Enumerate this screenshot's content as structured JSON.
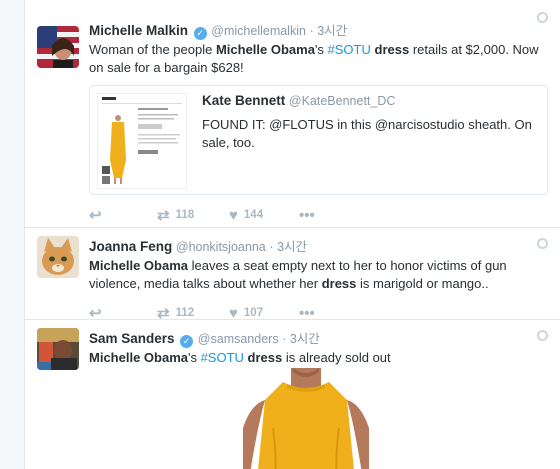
{
  "tweets": [
    {
      "name": "Michelle Malkin",
      "handle": "@michellemalkin",
      "time": "· 3시간",
      "segments": [
        {
          "t": "Woman of the people ",
          "s": ""
        },
        {
          "t": "Michelle Obama",
          "s": "b"
        },
        {
          "t": "'s ",
          "s": ""
        },
        {
          "t": "#SOTU",
          "s": "hl"
        },
        {
          "t": " ",
          "s": ""
        },
        {
          "t": "dress",
          "s": "b"
        },
        {
          "t": " retails at $2,000. Now on sale for a bargain $628!",
          "s": ""
        }
      ],
      "quote": {
        "name": "Kate Bennett",
        "handle": "@KateBennett_DC",
        "text": "FOUND IT:  @FLOTUS in this @narcisostudio sheath. On sale, too."
      },
      "retweets": "118",
      "likes": "144"
    },
    {
      "name": "Joanna Feng",
      "handle": "@honkitsjoanna",
      "time": "· 3시간",
      "segments": [
        {
          "t": "Michelle Obama",
          "s": "b"
        },
        {
          "t": " leaves a seat empty next to her to honor victims of gun violence, media talks about whether her ",
          "s": ""
        },
        {
          "t": "dress",
          "s": "b"
        },
        {
          "t": " is marigold or mango..",
          "s": ""
        }
      ],
      "retweets": "112",
      "likes": "107"
    },
    {
      "name": "Sam Sanders",
      "handle": "@samsanders",
      "time": "· 3시간",
      "segments": [
        {
          "t": "Michelle Obama",
          "s": "b"
        },
        {
          "t": "'s ",
          "s": ""
        },
        {
          "t": "#SOTU",
          "s": "hl"
        },
        {
          "t": " ",
          "s": ""
        },
        {
          "t": "dress",
          "s": "b"
        },
        {
          "t": " is already sold out",
          "s": ""
        }
      ]
    }
  ],
  "icons": {
    "reply": "reply-icon",
    "retweet": "retweet-icon",
    "like": "heart-icon",
    "more": "more-icon"
  },
  "colors": {
    "link": "#1b95e0",
    "verified": "#55acee",
    "dress": "#f0b01c"
  }
}
